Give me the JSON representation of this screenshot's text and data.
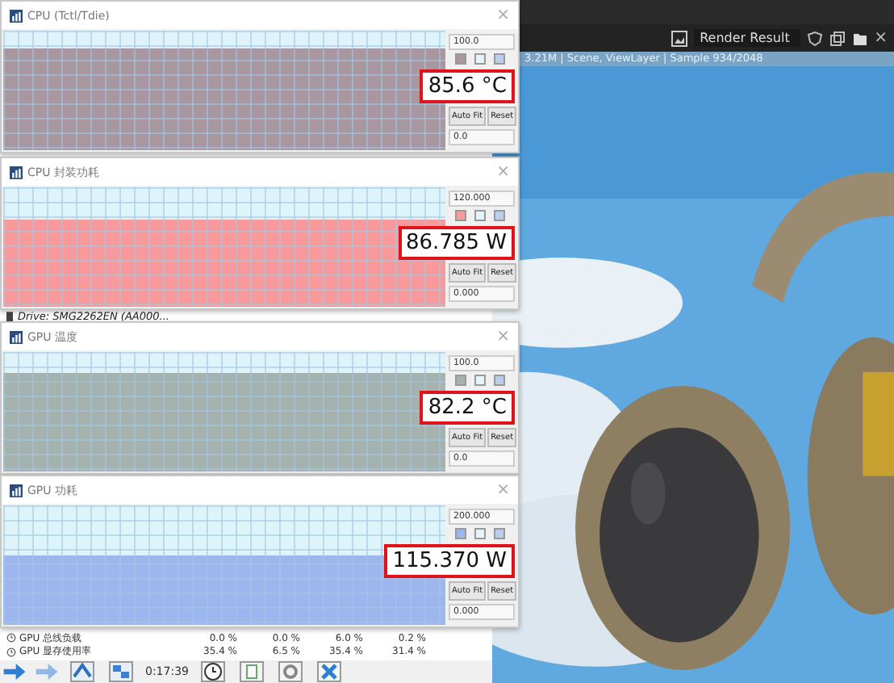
{
  "monitor": {
    "drive_row": "Drive: SMG2262EN (AA000...",
    "rows": [
      {
        "label": "GPU 总线负载",
        "values": [
          "0.0 %",
          "0.0 %",
          "6.0 %",
          "0.2 %"
        ]
      },
      {
        "label": "GPU 显存使用率",
        "values": [
          "35.4 %",
          "6.5 %",
          "35.4 %",
          "31.4 %"
        ]
      }
    ],
    "timer": "0:17:39"
  },
  "close_glyph": "×",
  "graph_windows": [
    {
      "title": "CPU (Tctl/Tdie)",
      "max": "100.0",
      "min": "0.0",
      "reading": "85.6 °C",
      "color": "#a8979f",
      "buttons": [
        "Auto Fit",
        "Reset"
      ]
    },
    {
      "title": "CPU 封装功耗",
      "max": "120.000",
      "min": "0.000",
      "reading": "86.785 W",
      "color": "#f89a9c",
      "buttons": [
        "Auto Fit",
        "Reset"
      ]
    },
    {
      "title": "GPU 温度",
      "max": "100.0",
      "min": "0.0",
      "reading": "82.2 °C",
      "color": "#a6b2ad",
      "buttons": [
        "Auto Fit",
        "Reset"
      ]
    },
    {
      "title": "GPU 功耗",
      "max": "200.000",
      "min": "0.000",
      "reading": "115.370 W",
      "color": "#9db6ee",
      "buttons": [
        "Auto Fit",
        "Reset"
      ]
    }
  ],
  "render": {
    "title": "Render Result",
    "info": "3.21M | Scene, ViewLayer | Sample 934/2048"
  }
}
